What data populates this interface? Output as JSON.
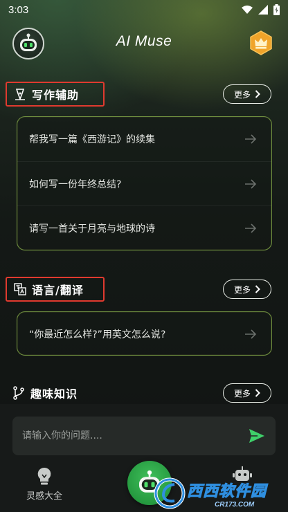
{
  "status_bar": {
    "time": "3:03"
  },
  "header": {
    "title": "AI Muse"
  },
  "sections": [
    {
      "title": "写作辅助",
      "more_label": "更多",
      "items": [
        "帮我写一篇《西游记》的续集",
        "如何写一份年终总结?",
        "请写一首关于月亮与地球的诗"
      ]
    },
    {
      "title": "语言/翻译",
      "more_label": "更多",
      "items": [
        "“你最近怎么样?”用英文怎么说?"
      ]
    },
    {
      "title": "趣味知识",
      "more_label": "更多",
      "items": []
    }
  ],
  "input": {
    "placeholder": "请输入你的问题...."
  },
  "bottom_nav": {
    "inspiration_label": "灵感大全"
  },
  "watermark": {
    "brand": "西西软件园",
    "url": "CR173.COM"
  },
  "colors": {
    "highlight_box": "#e03a2f",
    "card_border": "#6f8f3f",
    "send_icon": "#3fcf6a",
    "nav_center": "#2fa84a"
  }
}
